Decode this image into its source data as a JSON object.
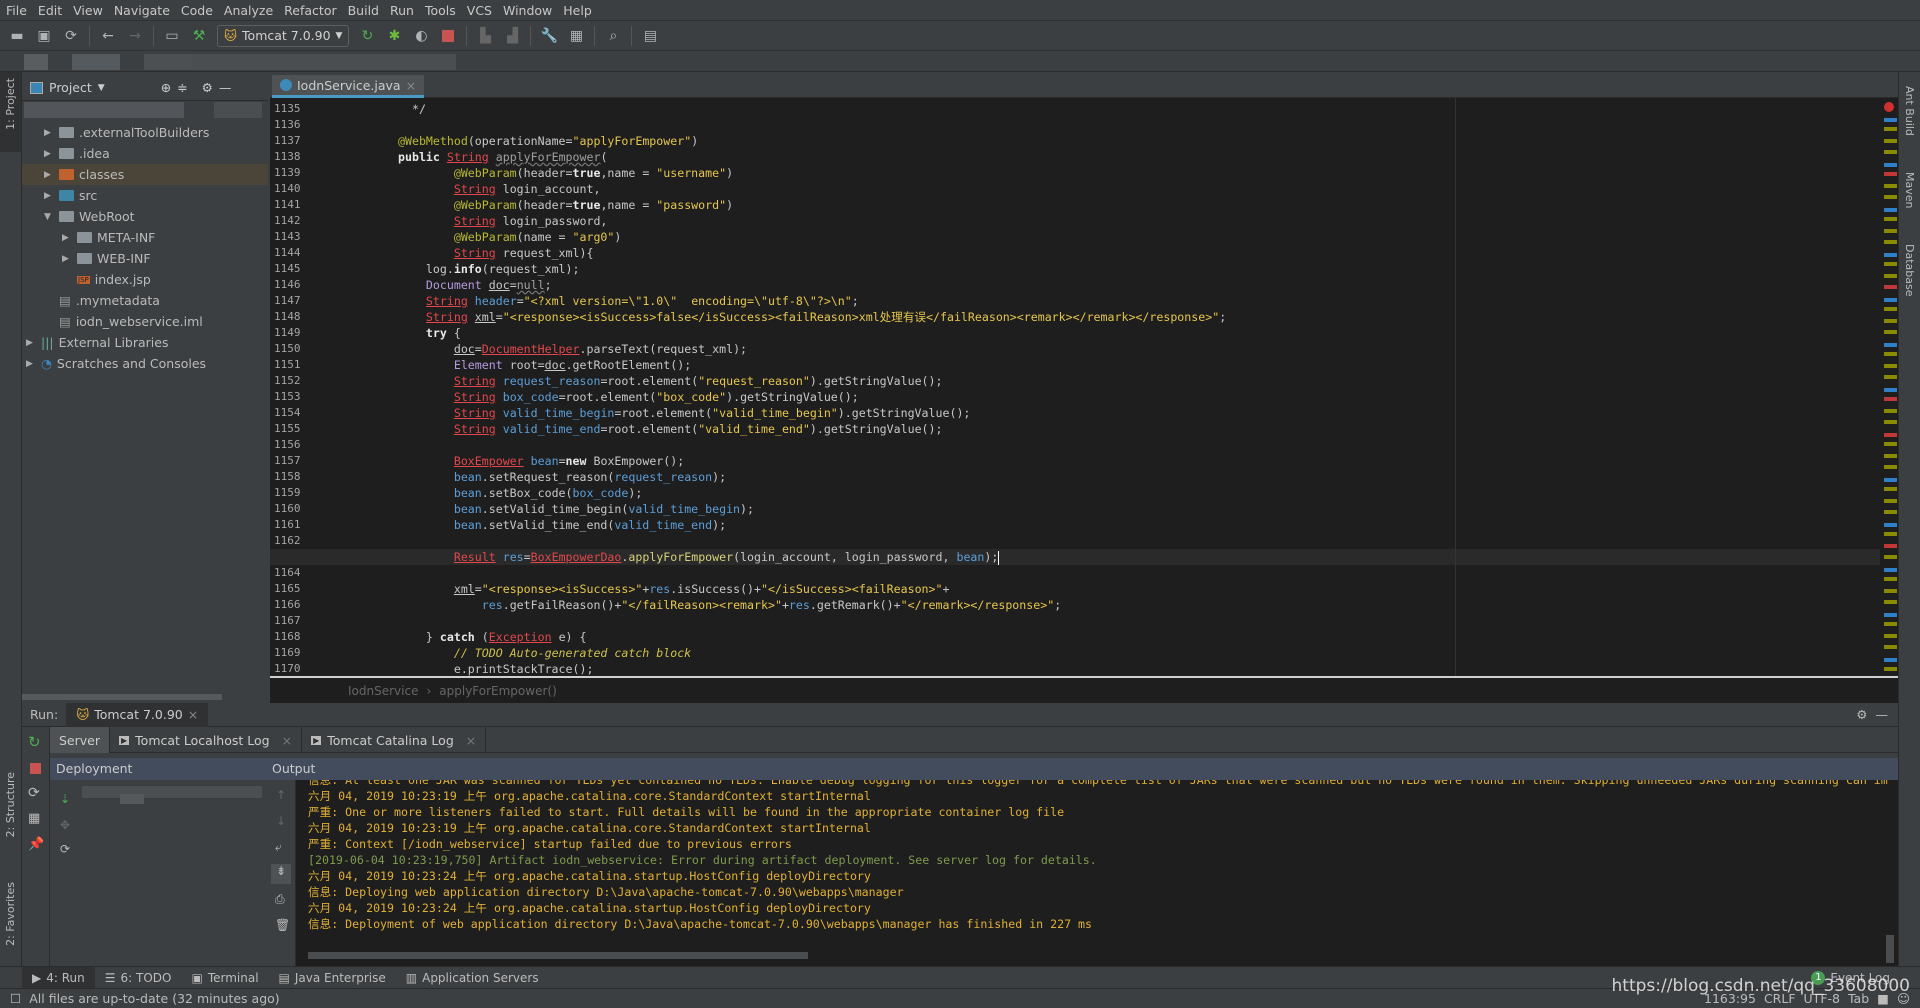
{
  "menu": [
    "File",
    "Edit",
    "View",
    "Navigate",
    "Code",
    "Analyze",
    "Refactor",
    "Build",
    "Run",
    "Tools",
    "VCS",
    "Window",
    "Help"
  ],
  "toolbar": {
    "run_config": "Tomcat 7.0.90"
  },
  "left_strip": {
    "project": "1: Project",
    "structure": "2: Structure",
    "favorites": "2: Favorites"
  },
  "right_strip": [
    "Ant Build",
    "Maven",
    "Database"
  ],
  "project_panel": {
    "title": "Project",
    "tree": [
      {
        "label": ".externalToolBuilders",
        "depth": 1,
        "type": "folder",
        "expanded": false
      },
      {
        "label": ".idea",
        "depth": 1,
        "type": "folder",
        "expanded": false
      },
      {
        "label": "classes",
        "depth": 1,
        "type": "folder-excluded",
        "expanded": false,
        "selected": true
      },
      {
        "label": "src",
        "depth": 1,
        "type": "folder-source",
        "expanded": false
      },
      {
        "label": "WebRoot",
        "depth": 1,
        "type": "folder",
        "expanded": true
      },
      {
        "label": "META-INF",
        "depth": 2,
        "type": "folder",
        "expanded": false
      },
      {
        "label": "WEB-INF",
        "depth": 2,
        "type": "folder",
        "expanded": false
      },
      {
        "label": "index.jsp",
        "depth": 2,
        "type": "jsp"
      },
      {
        "label": ".mymetadata",
        "depth": 1,
        "type": "file"
      },
      {
        "label": "iodn_webservice.iml",
        "depth": 1,
        "type": "file"
      },
      {
        "label": "External Libraries",
        "depth": 0,
        "type": "libraries",
        "expanded": false
      },
      {
        "label": "Scratches and Consoles",
        "depth": 0,
        "type": "scratches",
        "expanded": false
      }
    ]
  },
  "editor": {
    "tab": "IodnService.java",
    "current_line": 1163,
    "lines": [
      {
        "n": 1135,
        "t": [
          [
            "p",
            "  */"
          ]
        ]
      },
      {
        "n": 1136,
        "t": []
      },
      {
        "n": 1137,
        "t": [
          [
            "a",
            "@WebMethod"
          ],
          [
            "p",
            "(operationName="
          ],
          [
            "s",
            "\"applyForEmpower\""
          ],
          [
            "p",
            ")"
          ]
        ]
      },
      {
        "n": 1138,
        "t": [
          [
            "k",
            "public "
          ],
          [
            "e",
            "String"
          ],
          [
            "p",
            " "
          ],
          [
            "u",
            "applyForEmpower"
          ],
          [
            "p",
            "("
          ]
        ]
      },
      {
        "n": 1139,
        "t": [
          [
            "p",
            "        "
          ],
          [
            "a",
            "@WebParam"
          ],
          [
            "p",
            "(header="
          ],
          [
            "k",
            "true"
          ],
          [
            "p",
            ",name = "
          ],
          [
            "s",
            "\"username\""
          ],
          [
            "p",
            ")"
          ]
        ]
      },
      {
        "n": 1140,
        "t": [
          [
            "p",
            "        "
          ],
          [
            "e",
            "String"
          ],
          [
            "p",
            " login_account,"
          ]
        ]
      },
      {
        "n": 1141,
        "t": [
          [
            "p",
            "        "
          ],
          [
            "a",
            "@WebParam"
          ],
          [
            "p",
            "(header="
          ],
          [
            "k",
            "true"
          ],
          [
            "p",
            ",name = "
          ],
          [
            "s",
            "\"password\""
          ],
          [
            "p",
            ")"
          ]
        ]
      },
      {
        "n": 1142,
        "t": [
          [
            "p",
            "        "
          ],
          [
            "e",
            "String"
          ],
          [
            "p",
            " login_password,"
          ]
        ]
      },
      {
        "n": 1143,
        "t": [
          [
            "p",
            "        "
          ],
          [
            "a",
            "@WebParam"
          ],
          [
            "p",
            "(name = "
          ],
          [
            "s",
            "\"arg0\""
          ],
          [
            "p",
            ")"
          ]
        ]
      },
      {
        "n": 1144,
        "t": [
          [
            "p",
            "        "
          ],
          [
            "e",
            "String"
          ],
          [
            "p",
            " request_xml){"
          ]
        ]
      },
      {
        "n": 1145,
        "t": [
          [
            "p",
            "    log."
          ],
          [
            "k",
            "info"
          ],
          [
            "p",
            "(request_xml);"
          ]
        ]
      },
      {
        "n": 1146,
        "t": [
          [
            "p",
            "    "
          ],
          [
            "t",
            "Document"
          ],
          [
            "p",
            " "
          ],
          [
            "un",
            "doc"
          ],
          [
            "p",
            "="
          ],
          [
            "u",
            "null"
          ],
          [
            "p",
            ";"
          ]
        ]
      },
      {
        "n": 1147,
        "t": [
          [
            "p",
            "    "
          ],
          [
            "e",
            "String"
          ],
          [
            "p",
            " "
          ],
          [
            "v",
            "header"
          ],
          [
            "p",
            "="
          ],
          [
            "s",
            "\"<?xml version=\\\"1.0\\\"  encoding=\\\"utf-8\\\"?>\\n\""
          ],
          [
            "p",
            ";"
          ]
        ]
      },
      {
        "n": 1148,
        "t": [
          [
            "p",
            "    "
          ],
          [
            "e",
            "String"
          ],
          [
            "p",
            " "
          ],
          [
            "un",
            "xml"
          ],
          [
            "p",
            "="
          ],
          [
            "s",
            "\"<response><isSuccess>false</isSuccess><failReason>xml处理有误</failReason><remark></remark></response>\""
          ],
          [
            "p",
            ";"
          ]
        ]
      },
      {
        "n": 1149,
        "t": [
          [
            "p",
            "    "
          ],
          [
            "k",
            "try"
          ],
          [
            "p",
            " {"
          ]
        ]
      },
      {
        "n": 1150,
        "t": [
          [
            "p",
            "        "
          ],
          [
            "un",
            "doc"
          ],
          [
            "p",
            "="
          ],
          [
            "e",
            "DocumentHelper"
          ],
          [
            "p",
            ".parseText(request_xml);"
          ]
        ]
      },
      {
        "n": 1151,
        "t": [
          [
            "p",
            "        "
          ],
          [
            "t",
            "Element"
          ],
          [
            "p",
            " root="
          ],
          [
            "un",
            "doc"
          ],
          [
            "p",
            ".getRootElement();"
          ]
        ]
      },
      {
        "n": 1152,
        "t": [
          [
            "p",
            "        "
          ],
          [
            "e",
            "String"
          ],
          [
            "p",
            " "
          ],
          [
            "v",
            "request_reason"
          ],
          [
            "p",
            "=root.element("
          ],
          [
            "s",
            "\"request_reason\""
          ],
          [
            "p",
            ").getStringValue();"
          ]
        ]
      },
      {
        "n": 1153,
        "t": [
          [
            "p",
            "        "
          ],
          [
            "e",
            "String"
          ],
          [
            "p",
            " "
          ],
          [
            "v",
            "box_code"
          ],
          [
            "p",
            "=root.element("
          ],
          [
            "s",
            "\"box_code\""
          ],
          [
            "p",
            ").getStringValue();"
          ]
        ]
      },
      {
        "n": 1154,
        "t": [
          [
            "p",
            "        "
          ],
          [
            "e",
            "String"
          ],
          [
            "p",
            " "
          ],
          [
            "v",
            "valid_time_begin"
          ],
          [
            "p",
            "=root.element("
          ],
          [
            "s",
            "\"valid_time_begin\""
          ],
          [
            "p",
            ").getStringValue();"
          ]
        ]
      },
      {
        "n": 1155,
        "t": [
          [
            "p",
            "        "
          ],
          [
            "e",
            "String"
          ],
          [
            "p",
            " "
          ],
          [
            "v",
            "valid_time_end"
          ],
          [
            "p",
            "=root.element("
          ],
          [
            "s",
            "\"valid_time_end\""
          ],
          [
            "p",
            ").getStringValue();"
          ]
        ]
      },
      {
        "n": 1156,
        "t": []
      },
      {
        "n": 1157,
        "t": [
          [
            "p",
            "        "
          ],
          [
            "e",
            "BoxEmpower"
          ],
          [
            "p",
            " "
          ],
          [
            "v",
            "bean"
          ],
          [
            "p",
            "="
          ],
          [
            "k",
            "new"
          ],
          [
            "p",
            " BoxEmpower();"
          ]
        ]
      },
      {
        "n": 1158,
        "t": [
          [
            "p",
            "        "
          ],
          [
            "v",
            "bean"
          ],
          [
            "p",
            ".setRequest_reason("
          ],
          [
            "v",
            "request_reason"
          ],
          [
            "p",
            ");"
          ]
        ]
      },
      {
        "n": 1159,
        "t": [
          [
            "p",
            "        "
          ],
          [
            "v",
            "bean"
          ],
          [
            "p",
            ".setBox_code("
          ],
          [
            "v",
            "box_code"
          ],
          [
            "p",
            ");"
          ]
        ]
      },
      {
        "n": 1160,
        "t": [
          [
            "p",
            "        "
          ],
          [
            "v",
            "bean"
          ],
          [
            "p",
            ".setValid_time_begin("
          ],
          [
            "v",
            "valid_time_begin"
          ],
          [
            "p",
            ");"
          ]
        ]
      },
      {
        "n": 1161,
        "t": [
          [
            "p",
            "        "
          ],
          [
            "v",
            "bean"
          ],
          [
            "p",
            ".setValid_time_end("
          ],
          [
            "v",
            "valid_time_end"
          ],
          [
            "p",
            ");"
          ]
        ]
      },
      {
        "n": 1162,
        "t": []
      },
      {
        "n": 1163,
        "t": [
          [
            "p",
            "        "
          ],
          [
            "e",
            "Result"
          ],
          [
            "p",
            " "
          ],
          [
            "v",
            "res"
          ],
          [
            "p",
            "="
          ],
          [
            "e",
            "BoxEmpowerDao"
          ],
          [
            "p",
            "."
          ],
          [
            "m",
            "applyForEmpower"
          ],
          [
            "p",
            "(login_account, login_password, "
          ],
          [
            "v",
            "bean"
          ],
          [
            "p",
            ");"
          ]
        ]
      },
      {
        "n": 1164,
        "t": []
      },
      {
        "n": 1165,
        "t": [
          [
            "p",
            "        "
          ],
          [
            "un",
            "xml"
          ],
          [
            "p",
            "="
          ],
          [
            "s",
            "\"<response><isSuccess>\""
          ],
          [
            "p",
            "+"
          ],
          [
            "v",
            "res"
          ],
          [
            "p",
            ".isSuccess()+"
          ],
          [
            "s",
            "\"</isSuccess><failReason>\""
          ],
          [
            "p",
            "+"
          ]
        ]
      },
      {
        "n": 1166,
        "t": [
          [
            "p",
            "            "
          ],
          [
            "v",
            "res"
          ],
          [
            "p",
            ".getFailReason()+"
          ],
          [
            "s",
            "\"</failReason><remark>\""
          ],
          [
            "p",
            "+"
          ],
          [
            "v",
            "res"
          ],
          [
            "p",
            ".getRemark()+"
          ],
          [
            "s",
            "\"</remark></response>\""
          ],
          [
            "p",
            ";"
          ]
        ]
      },
      {
        "n": 1167,
        "t": []
      },
      {
        "n": 1168,
        "t": [
          [
            "p",
            "    } "
          ],
          [
            "k",
            "catch"
          ],
          [
            "p",
            " ("
          ],
          [
            "e",
            "Exception"
          ],
          [
            "p",
            " e) {"
          ]
        ]
      },
      {
        "n": 1169,
        "t": [
          [
            "p",
            "        "
          ],
          [
            "c",
            "// TODO Auto-generated catch block"
          ]
        ]
      },
      {
        "n": 1170,
        "t": [
          [
            "p",
            "        e.printStackTrace();"
          ]
        ]
      }
    ],
    "breadcrumb": [
      "IodnService",
      "applyForEmpower()"
    ]
  },
  "run_panel": {
    "label": "Run:",
    "config_tab": "Tomcat 7.0.90",
    "tabs": [
      "Server",
      "Tomcat Localhost Log",
      "Tomcat Catalina Log"
    ],
    "deployment_header": "Deployment",
    "output_header": "Output",
    "output": [
      {
        "text": "信息: At least one JAR was scanned for TLDs yet contained no TLDs. Enable debug logging for this logger for a complete list of JARs that were scanned but no TLDs were found in them. Skipping unneeded JARs during scanning can im",
        "level": "info"
      },
      {
        "text": "六月 04, 2019 10:23:19 上午 org.apache.catalina.core.StandardContext startInternal",
        "level": "info"
      },
      {
        "text": "严重: One or more listeners failed to start. Full details will be found in the appropriate container log file",
        "level": "info"
      },
      {
        "text": "六月 04, 2019 10:23:19 上午 org.apache.catalina.core.StandardContext startInternal",
        "level": "info"
      },
      {
        "text": "严重: Context [/iodn_webservice] startup failed due to previous errors",
        "level": "info"
      },
      {
        "text": "[2019-06-04 10:23:19,750] Artifact iodn_webservice: Error during artifact deployment. See server log for details.",
        "level": "artifact"
      },
      {
        "text": "六月 04, 2019 10:23:24 上午 org.apache.catalina.startup.HostConfig deployDirectory",
        "level": "info"
      },
      {
        "text": "信息: Deploying web application directory D:\\Java\\apache-tomcat-7.0.90\\webapps\\manager",
        "level": "info"
      },
      {
        "text": "六月 04, 2019 10:23:24 上午 org.apache.catalina.startup.HostConfig deployDirectory",
        "level": "info"
      },
      {
        "text": "信息: Deployment of web application directory D:\\Java\\apache-tomcat-7.0.90\\webapps\\manager has finished in 227 ms",
        "level": "info"
      }
    ]
  },
  "bottom_tabs": [
    "4: Run",
    "6: TODO",
    "Terminal",
    "Java Enterprise",
    "Application Servers"
  ],
  "event_log": {
    "count": "1",
    "label": "Event Log"
  },
  "status": {
    "message": "All files are up-to-date (32 minutes ago)",
    "position": "1163:95",
    "line_ending": "CRLF",
    "encoding": "UTF-8",
    "indent": "Tab"
  },
  "watermark": "https://blog.csdn.net/qq_33608000",
  "colors": {
    "accent": "#4a9ac4",
    "error": "#e0484c",
    "string": "#e6c64c",
    "console": "#e0b035",
    "artifact": "#7f9a4e"
  }
}
